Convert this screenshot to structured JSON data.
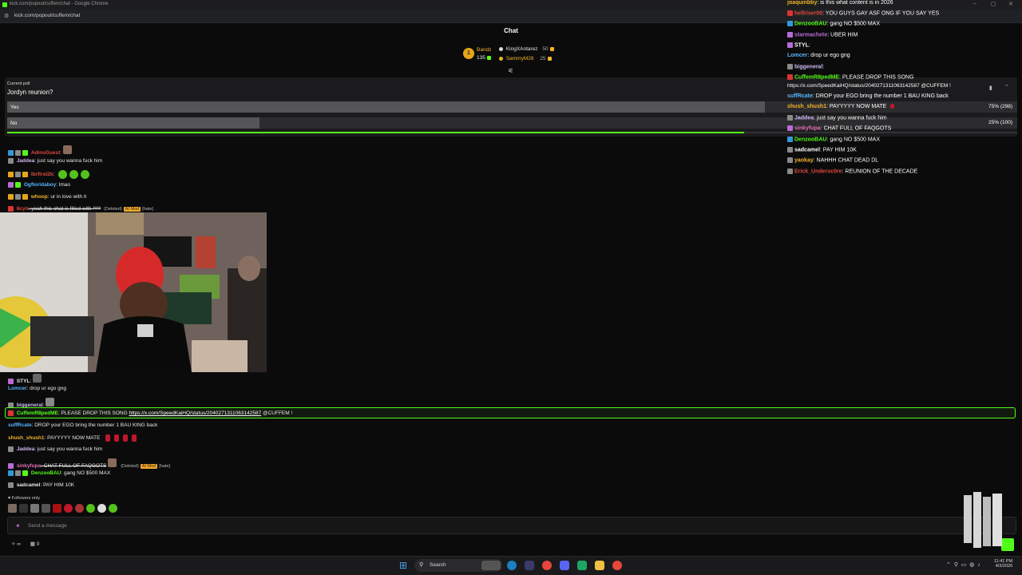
{
  "browser": {
    "title": "kick.com/popout/cuffem/chat - Google Chrome",
    "url": "kick.com/popout/cuffem/chat",
    "minimize": "–",
    "maximize": "▢",
    "close": "✕"
  },
  "chat": {
    "title": "Chat",
    "gifter": {
      "rank": "1",
      "name": "Bandz",
      "count": "135",
      "leaders": [
        {
          "name": "KingXAntarez",
          "value": "50"
        },
        {
          "name": "SammyM28",
          "value": "25"
        }
      ]
    },
    "poll": {
      "label": "Current poll",
      "question": "Jordyn reunion?",
      "options": [
        {
          "label": "Yes",
          "result": "75% (298)",
          "fraction": 0.75
        },
        {
          "label": "No",
          "result": "25% (100)",
          "fraction": 0.25
        }
      ],
      "time_remaining": 0.73,
      "pin_icon": "pin-icon",
      "collapse_icon": "chevron-up-icon"
    },
    "messages_top": [
      {
        "user": "AdinsGuest",
        "text": ":",
        "color": "#e0483e"
      },
      {
        "user": "Jaddea",
        "text": ": just say you wanna fuck him",
        "color": "#d0b9f2"
      },
      {
        "user": "Ibrfirst2k",
        "text": ":",
        "color": "#e0483e"
      },
      {
        "user": "Ogfloridaboy",
        "text": ": lmao",
        "color": "#56b6ff"
      },
      {
        "user": "whoop",
        "text": ": ur in love with it",
        "color": "#f0b429"
      },
      {
        "user": "6cyn",
        "text": ": yeah this chat is filled with ****",
        "color": "#e0483e",
        "deleted": "(Deleted)",
        "ai_mod": "AI Mod",
        "reason": "[hate]"
      }
    ],
    "messages_bottom": [
      {
        "user": "STYL",
        "text": ":",
        "color": "#e8e8e8"
      },
      {
        "user": "Lomcer",
        "text": ": drop ur ego gng",
        "color": "#56b6ff"
      },
      {
        "user": "biggeneral",
        "text": ":",
        "color": "#d0b9f2"
      },
      {
        "user": "suffRcate",
        "text": ": DROP your EGO bring the number 1 BAU KING back",
        "color": "#56b6ff"
      },
      {
        "user": "shush_shush1",
        "text": ": PAYYYYY NOW MATE",
        "color": "#f0b429"
      },
      {
        "user": "Jaddea",
        "text": ": just say you wanna fuck him",
        "color": "#d0b9f2"
      },
      {
        "user": "sinkyfupa",
        "text": ": CHAT FULL OF FAQGOTS",
        "color": "#e36fb5",
        "deleted": "(Deleted)",
        "ai_mod": "AI Mod",
        "reason": "[hate]"
      },
      {
        "user": "DenzooBAU",
        "text": ": gang NO $500 MAX",
        "color": "#53fc18"
      },
      {
        "user": "sadcamel",
        "text": ": PAY HIM 10K",
        "color": "#e8e8e8"
      }
    ],
    "highlight": {
      "user": "CuffemR8pedME",
      "text": ": PLEASE DROP THIS SONG ",
      "link": "https://x.com/SpeedKaiHQ/status/2040271311063142587",
      "suffix": " @CUFFEM !"
    },
    "followers_only": "Followers only",
    "input_placeholder": "Send a message",
    "points_label": "∞",
    "gift_count": "0"
  },
  "overlay_chat": [
    {
      "user": "joaquinbby",
      "text": ": is this what content is in 2026",
      "color": "#f0b429"
    },
    {
      "user": "hellriser00",
      "text": ": YOU GUYS GAY ASF ONG IF YOU SAY YES",
      "color": "#e0483e"
    },
    {
      "user": "DenzooBAU",
      "text": ": gang NO $500 MAX",
      "color": "#53fc18"
    },
    {
      "user": "starmachete",
      "text": ": UBER HIM",
      "color": "#b86bd6"
    },
    {
      "user": "STYL",
      "text": ":",
      "color": "#ffffff"
    },
    {
      "user": "Lomcer",
      "text": ": drop ur ego gng",
      "color": "#56b6ff"
    },
    {
      "user": "biggeneral",
      "text": ":",
      "color": "#d0b9f2"
    },
    {
      "user": "CuffemR8pedME",
      "text": ": PLEASE DROP THIS SONG",
      "color": "#53fc18"
    },
    {
      "user": "",
      "text": "https://x.com/SpeedKaiHQ/status/2040271311063142587 @CUFFEM !",
      "color": "#ffffff"
    },
    {
      "user": "suffRcate",
      "text": ": DROP your EGO bring the number 1 BAU KING back",
      "color": "#56b6ff"
    },
    {
      "user": "shush_shush1",
      "text": ": PAYYYYY NOW MATE",
      "color": "#f0b429"
    },
    {
      "user": "Jaddea",
      "text": ": just say you wanna fuck him",
      "color": "#d0b9f2"
    },
    {
      "user": "sinkyfupa",
      "text": ": CHAT FULL OF FAQGOTS",
      "color": "#e36fb5"
    },
    {
      "user": "DenzooBAU",
      "text": ": gang NO $500 MAX",
      "color": "#53fc18"
    },
    {
      "user": "sadcamel",
      "text": ": PAY HIM 10K",
      "color": "#ffffff"
    },
    {
      "user": "yaokay",
      "text": ": NAHHH CHAT DEAD DL",
      "color": "#f0b429"
    },
    {
      "user": "Erick_Undersc0re",
      "text": ": REUNION OF THE DECADE",
      "color": "#e0483e"
    }
  ],
  "taskbar": {
    "search": "Search",
    "time": "11:41 PM",
    "date": "4/3/2026"
  },
  "colors": {
    "accent": "#53fc18",
    "bg": "#0b0b0c",
    "poll_bg": "#1b1b1d"
  }
}
